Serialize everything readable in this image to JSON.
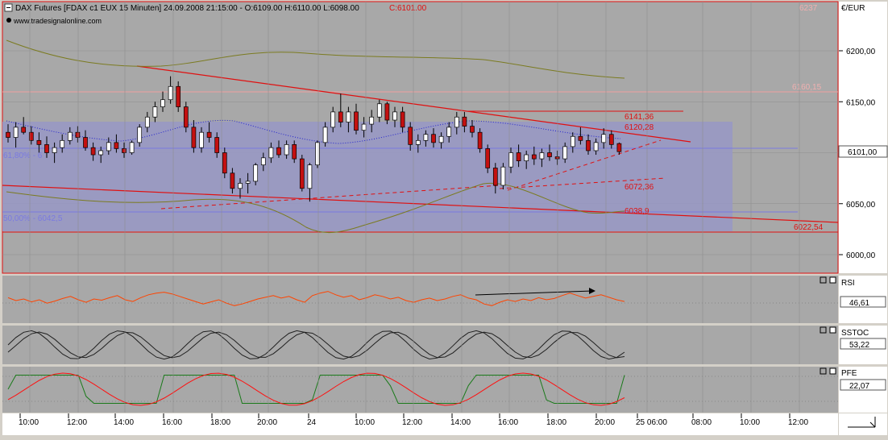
{
  "header": {
    "symbol_label": "DAX Futures [FDAX c1 EUX  15 Minuten] 24.09.2008 21:15:00 - O:6109.00 H:6110.00 L:6098.00",
    "close_label": "C:6101.00",
    "watermark": "www.tradesignalonline.com"
  },
  "colors": {
    "plot_bg": "#a8a8a8",
    "grid": "#8e8e8e",
    "fib_box": "#9898c6",
    "bull_candle": "#ffffff",
    "bear_candle": "#c41010",
    "trend_red": "#e01010",
    "olive_band": "#7b7b20",
    "dotted_ma": "#2020d0",
    "rsi_line": "#ff4400",
    "stoch_line": "#202020",
    "pfe_green": "#1a7a1a",
    "pfe_red": "#ff1010"
  },
  "price_axis": {
    "unit": "€/EUR",
    "top_label": "6237",
    "ticks": [
      "6200,00",
      "6150,00",
      "6100,00",
      "6050,00",
      "6000,00"
    ],
    "current_price": "6101,00"
  },
  "levels": {
    "fib_top": "61,80% - 6",
    "fib_mid": "50,00% - 6042,5",
    "l6160": "6160,15",
    "l6141": "6141,36",
    "l6120": "6120,28",
    "l6072": "6072,36",
    "l6038": "6038,9",
    "l6022": "6022,54"
  },
  "indicators": {
    "rsi": {
      "name": "RSI",
      "value": "46,61"
    },
    "sstoc": {
      "name": "SSTOC",
      "value": "53,22"
    },
    "pfe": {
      "name": "PFE",
      "value": "22,07"
    }
  },
  "time_axis": [
    "10:00",
    "12:00",
    "14:00",
    "16:00",
    "18:00",
    "20:00",
    "24",
    "10:00",
    "12:00",
    "14:00",
    "16:00",
    "18:00",
    "20:00",
    "25 06:00",
    "08:00",
    "10:00",
    "12:00"
  ],
  "chart_data": {
    "type": "candlestick",
    "symbol": "DAX Futures [FDAX c1 EUX  15 Minuten]",
    "last_bar": {
      "date": "24.09.2008 21:15:00",
      "open": 6109.0,
      "high": 6110.0,
      "low": 6098.0,
      "close": 6101.0
    },
    "y_range": [
      5980,
      6237
    ],
    "candles": [
      [
        6120,
        6128,
        6110,
        6115
      ],
      [
        6115,
        6130,
        6105,
        6125
      ],
      [
        6125,
        6135,
        6118,
        6120
      ],
      [
        6120,
        6126,
        6108,
        6112
      ],
      [
        6112,
        6120,
        6100,
        6108
      ],
      [
        6108,
        6116,
        6095,
        6100
      ],
      [
        6100,
        6110,
        6090,
        6105
      ],
      [
        6105,
        6118,
        6100,
        6112
      ],
      [
        6112,
        6125,
        6108,
        6120
      ],
      [
        6120,
        6126,
        6110,
        6115
      ],
      [
        6115,
        6122,
        6102,
        6105
      ],
      [
        6105,
        6110,
        6092,
        6098
      ],
      [
        6098,
        6106,
        6090,
        6102
      ],
      [
        6102,
        6115,
        6098,
        6110
      ],
      [
        6110,
        6118,
        6100,
        6104
      ],
      [
        6104,
        6110,
        6095,
        6100
      ],
      [
        6100,
        6112,
        6098,
        6110
      ],
      [
        6110,
        6128,
        6106,
        6125
      ],
      [
        6125,
        6140,
        6120,
        6135
      ],
      [
        6135,
        6150,
        6130,
        6145
      ],
      [
        6145,
        6160,
        6140,
        6152
      ],
      [
        6152,
        6175,
        6148,
        6165
      ],
      [
        6165,
        6170,
        6140,
        6145
      ],
      [
        6145,
        6150,
        6120,
        6125
      ],
      [
        6125,
        6132,
        6100,
        6105
      ],
      [
        6105,
        6125,
        6100,
        6120
      ],
      [
        6120,
        6130,
        6110,
        6115
      ],
      [
        6115,
        6120,
        6095,
        6100
      ],
      [
        6100,
        6105,
        6075,
        6080
      ],
      [
        6080,
        6085,
        6060,
        6065
      ],
      [
        6065,
        6075,
        6055,
        6070
      ],
      [
        6070,
        6080,
        6060,
        6072
      ],
      [
        6072,
        6090,
        6068,
        6088
      ],
      [
        6088,
        6100,
        6082,
        6095
      ],
      [
        6095,
        6110,
        6090,
        6105
      ],
      [
        6105,
        6112,
        6095,
        6098
      ],
      [
        6098,
        6112,
        6094,
        6108
      ],
      [
        6108,
        6112,
        6090,
        6094
      ],
      [
        6094,
        6098,
        6062,
        6065
      ],
      [
        6065,
        6090,
        6052,
        6088
      ],
      [
        6088,
        6112,
        6085,
        6110
      ],
      [
        6110,
        6130,
        6106,
        6125
      ],
      [
        6125,
        6145,
        6120,
        6140
      ],
      [
        6140,
        6158,
        6125,
        6130
      ],
      [
        6130,
        6145,
        6120,
        6140
      ],
      [
        6140,
        6148,
        6118,
        6122
      ],
      [
        6122,
        6135,
        6115,
        6128
      ],
      [
        6128,
        6142,
        6120,
        6135
      ],
      [
        6135,
        6152,
        6130,
        6148
      ],
      [
        6148,
        6150,
        6128,
        6132
      ],
      [
        6132,
        6145,
        6125,
        6140
      ],
      [
        6140,
        6145,
        6120,
        6125
      ],
      [
        6125,
        6130,
        6102,
        6108
      ],
      [
        6108,
        6118,
        6100,
        6112
      ],
      [
        6112,
        6122,
        6106,
        6118
      ],
      [
        6118,
        6124,
        6105,
        6110
      ],
      [
        6110,
        6120,
        6104,
        6116
      ],
      [
        6116,
        6130,
        6110,
        6125
      ],
      [
        6125,
        6140,
        6118,
        6135
      ],
      [
        6135,
        6140,
        6120,
        6126
      ],
      [
        6126,
        6132,
        6115,
        6120
      ],
      [
        6120,
        6124,
        6100,
        6104
      ],
      [
        6104,
        6108,
        6080,
        6085
      ],
      [
        6085,
        6090,
        6060,
        6068
      ],
      [
        6068,
        6090,
        6064,
        6086
      ],
      [
        6086,
        6105,
        6080,
        6100
      ],
      [
        6100,
        6108,
        6086,
        6092
      ],
      [
        6092,
        6102,
        6084,
        6098
      ],
      [
        6098,
        6106,
        6088,
        6094
      ],
      [
        6094,
        6104,
        6086,
        6100
      ],
      [
        6100,
        6108,
        6092,
        6096
      ],
      [
        6096,
        6102,
        6088,
        6094
      ],
      [
        6094,
        6110,
        6090,
        6106
      ],
      [
        6106,
        6120,
        6100,
        6116
      ],
      [
        6116,
        6125,
        6108,
        6112
      ],
      [
        6112,
        6118,
        6098,
        6102
      ],
      [
        6102,
        6114,
        6098,
        6110
      ],
      [
        6110,
        6124,
        6104,
        6118
      ],
      [
        6118,
        6122,
        6104,
        6108
      ],
      [
        6109,
        6110,
        6098,
        6101
      ]
    ]
  }
}
